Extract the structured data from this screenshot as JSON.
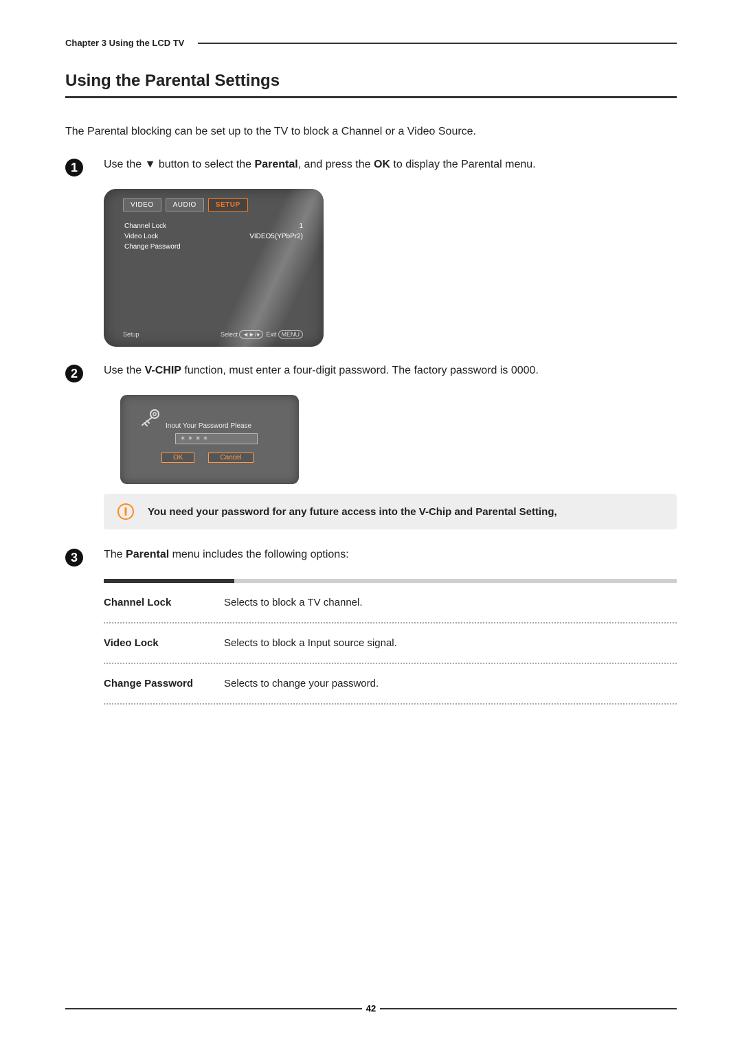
{
  "chapter": "Chapter 3 Using the LCD TV",
  "title": "Using  the Parental Settings",
  "intro": "The Parental blocking can be set up to the TV to block a Channel or a Video Source.",
  "step1": {
    "pre": "Use the ▼ button to select the ",
    "bold1": "Parental",
    "mid": ",  and press the ",
    "bold2": "OK",
    "post": " to display the Parental menu."
  },
  "tv": {
    "tabs": {
      "video": "VIDEO",
      "audio": "AUDIO",
      "setup": "SETUP"
    },
    "rows": [
      {
        "label": "Channel Lock",
        "value": "1"
      },
      {
        "label": "Video Lock",
        "value": "VIDEO5(YPbPr2)"
      },
      {
        "label": "Change Password",
        "value": ""
      }
    ],
    "footer_left": "Setup",
    "footer_nav": "◄►/♦",
    "footer_select": "Select",
    "footer_exit": "Exit",
    "footer_menu": "MENU"
  },
  "step2": {
    "pre": "Use the ",
    "bold": "V-CHIP",
    "post": " function, must enter a four-digit password. The factory password is 0000."
  },
  "pw": {
    "prompt": "Inout Your Password Please",
    "value": "＊＊＊＊",
    "ok": "OK",
    "cancel": "Cancel"
  },
  "warning": "You need your password for any  future access into the V-Chip and Parental Setting,",
  "step3": {
    "pre": "The ",
    "bold": "Parental",
    "post": " menu includes the following options:"
  },
  "options": [
    {
      "name": "Channel Lock",
      "desc": "Selects to block a TV channel."
    },
    {
      "name": "Video Lock",
      "desc": "Selects to block a Input source signal."
    },
    {
      "name": "Change Password",
      "desc": "Selects to change your password."
    }
  ],
  "page_number": "42"
}
